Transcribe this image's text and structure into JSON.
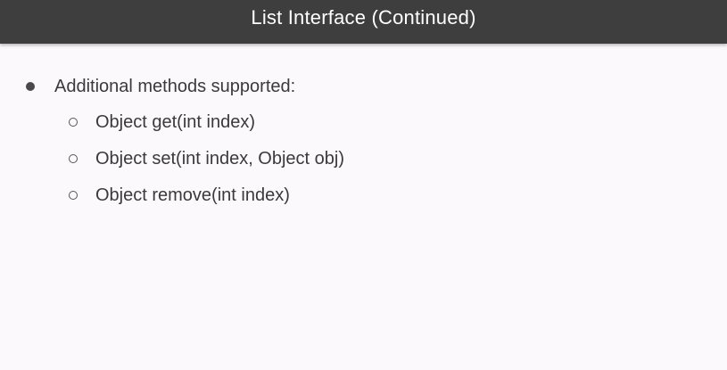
{
  "slide": {
    "title": "List Interface (Continued)",
    "bullets": [
      {
        "text": "Additional methods supported:",
        "subitems": [
          {
            "text": "Object get(int index)"
          },
          {
            "text": "Object set(int index, Object obj)"
          },
          {
            "text": "Object remove(int index)"
          }
        ]
      }
    ]
  },
  "colors": {
    "title_bar": "#3e3e3e",
    "title_text": "#ffffff",
    "background": "#fbf9fc",
    "body_text": "#3a3a3a"
  }
}
